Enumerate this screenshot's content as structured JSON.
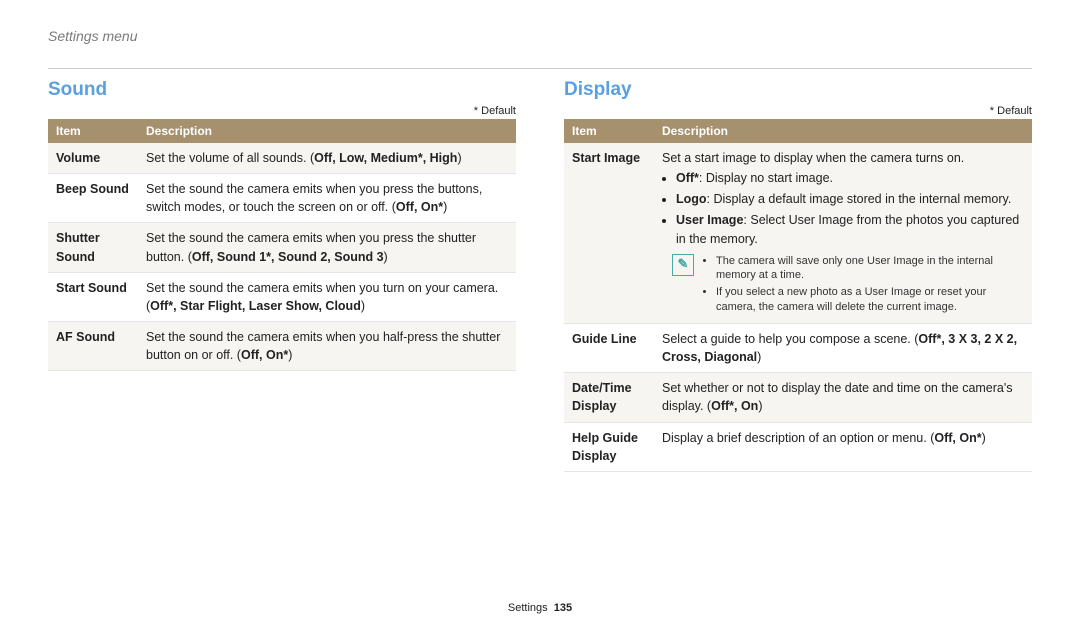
{
  "breadcrumb": "Settings menu",
  "footer_section": "Settings",
  "footer_page": "135",
  "default_label": "* Default",
  "headers": {
    "item": "Item",
    "description": "Description"
  },
  "sound": {
    "title": "Sound",
    "rows": [
      {
        "item": "Volume",
        "pre": "Set the volume of all sounds. (",
        "opts": "Off, Low, Medium*, High",
        "post": ")"
      },
      {
        "item": "Beep Sound",
        "pre": "Set the sound the camera emits when you press the buttons, switch modes, or touch the screen on or off. (",
        "opts": "Off, On*",
        "post": ")"
      },
      {
        "item": "Shutter Sound",
        "pre": "Set the sound the camera emits when you press the shutter button. (",
        "opts": "Off, Sound 1*, Sound 2, Sound 3",
        "post": ")"
      },
      {
        "item": "Start Sound",
        "pre": "Set the sound the camera emits when you turn on your camera. (",
        "opts": "Off*, Star Flight, Laser Show, Cloud",
        "post": ")"
      },
      {
        "item": "AF Sound",
        "pre": "Set the sound the camera emits when you half-press the shutter button on or off. (",
        "opts": "Off, On*",
        "post": ")"
      }
    ]
  },
  "display": {
    "title": "Display",
    "start_image": {
      "item": "Start Image",
      "intro": "Set a start image to display when the camera turns on.",
      "b1_label": "Off*",
      "b1_rest": ": Display no start image.",
      "b2_label": "Logo",
      "b2_rest": ": Display a default image stored in the internal memory.",
      "b3_label": "User Image",
      "b3_rest": ": Select User Image from the photos you captured in the memory.",
      "note1": "The camera will save only one User Image in the internal memory at a time.",
      "note2": "If you select a new photo as a User Image or reset your camera, the camera will delete the current image."
    },
    "guide_line": {
      "item": "Guide Line",
      "pre": "Select a guide to help you compose a scene. (",
      "opts": "Off*, 3 X 3, 2 X 2, Cross, Diagonal",
      "post": ")"
    },
    "date_time": {
      "item": "Date/Time Display",
      "pre": "Set whether or not to display the date and time on the camera's display. (",
      "opts": "Off*, On",
      "post": ")"
    },
    "help_guide": {
      "item": "Help Guide Display",
      "pre": "Display a brief description of an option or menu. (",
      "opts": "Off, On*",
      "post": ")"
    }
  }
}
